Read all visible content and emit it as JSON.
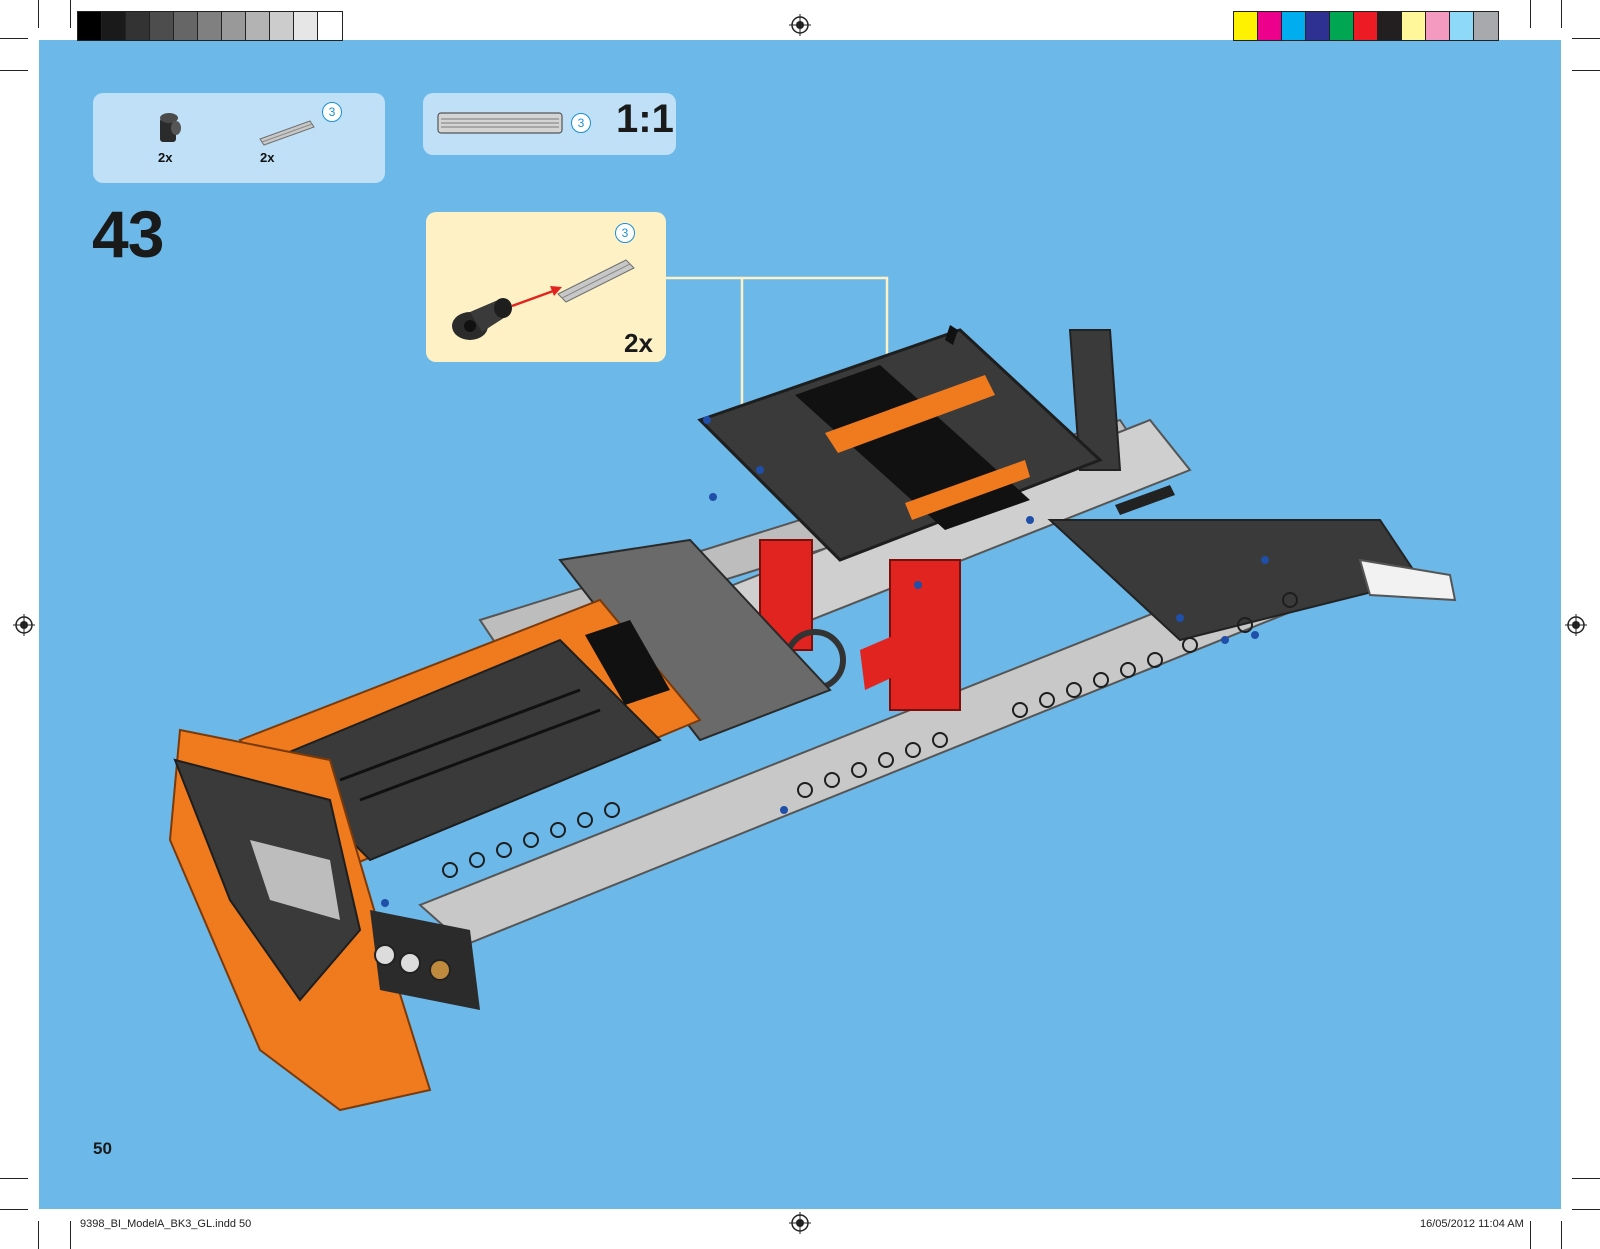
{
  "step": {
    "number": "43"
  },
  "parts_list": {
    "items": [
      {
        "name": "connector-part",
        "quantity": "2x"
      },
      {
        "name": "axle-part",
        "quantity": "2x",
        "length_badge": "3"
      }
    ]
  },
  "ruler": {
    "length_badge": "3",
    "scale": "1:1"
  },
  "sub_assembly": {
    "length_badge": "3",
    "quantity": "2x"
  },
  "page": {
    "number": "50"
  },
  "slug": {
    "file": "9398_BI_ModelA_BK3_GL.indd   50",
    "date": "16/05/2012   11:04 AM"
  },
  "colors": {
    "background": "#6cb8e8",
    "callout": "#bfe0f7",
    "subassembly": "#fdf1c5",
    "technic_orange": "#f07a1e",
    "dark_gray": "#3a3a3a",
    "light_gray": "#c8c8c8",
    "red": "#e1241f",
    "badge_blue": "#1a8fd6"
  },
  "gray_swatches": [
    "#000000",
    "#1a1a1a",
    "#333333",
    "#4d4d4d",
    "#666666",
    "#808080",
    "#999999",
    "#b3b3b3",
    "#cccccc",
    "#e6e6e6",
    "#ffffff"
  ],
  "color_swatches": [
    "#fff200",
    "#ec008c",
    "#00aeef",
    "#2e3192",
    "#00a651",
    "#ed1c24",
    "#231f20",
    "#fff799",
    "#f49ac1",
    "#8ed8f8",
    "#a7a9ac"
  ]
}
